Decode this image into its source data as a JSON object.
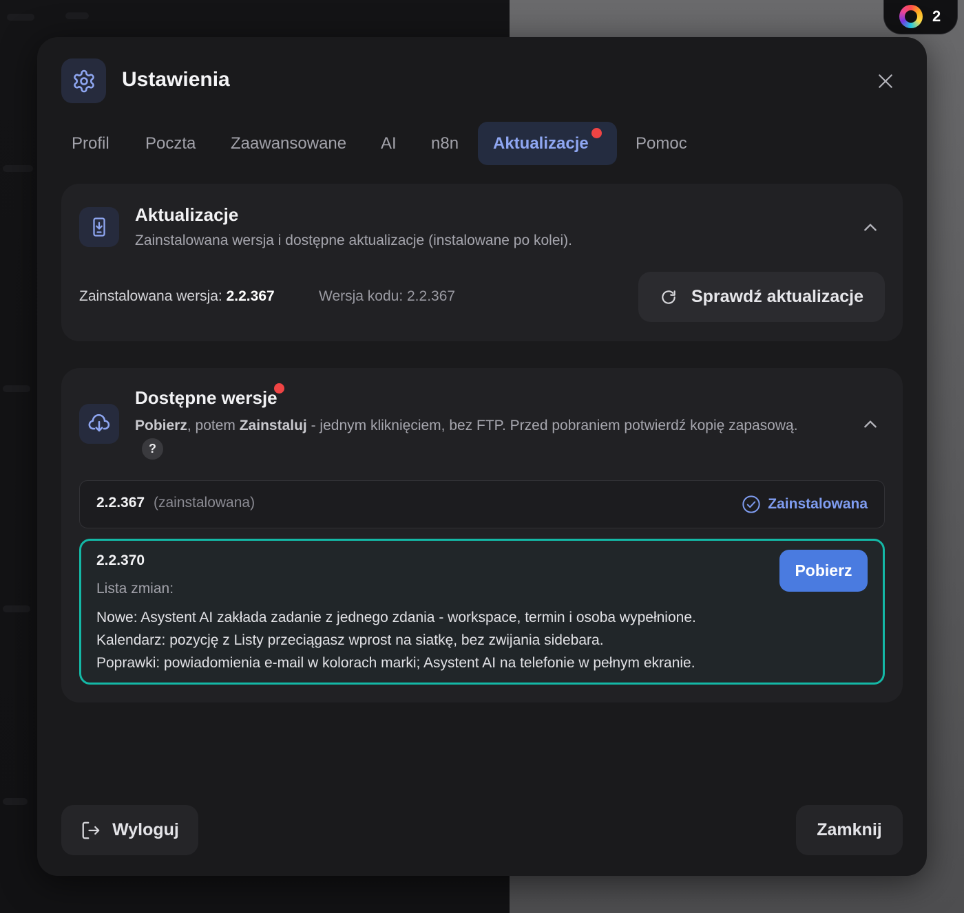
{
  "badge": {
    "count": "2"
  },
  "modal": {
    "title": "Ustawienia",
    "tabs": [
      {
        "label": "Profil"
      },
      {
        "label": "Poczta"
      },
      {
        "label": "Zaawansowane"
      },
      {
        "label": "AI"
      },
      {
        "label": "n8n"
      },
      {
        "label": "Aktualizacje",
        "active": true,
        "notification": true
      },
      {
        "label": "Pomoc"
      }
    ]
  },
  "updates": {
    "title": "Aktualizacje",
    "subtitle": "Zainstalowana wersja i dostępne aktualizacje (instalowane po kolei).",
    "installed_label": "Zainstalowana wersja:",
    "installed_version": "2.2.367",
    "code_version": "Wersja kodu: 2.2.367",
    "check_button": "Sprawdź aktualizacje"
  },
  "available": {
    "title": "Dostępne wersje",
    "desc_bold1": "Pobierz",
    "desc_mid": ", potem ",
    "desc_bold2": "Zainstaluj",
    "desc_rest": " - jednym kliknięciem, bez FTP. Przed pobraniem potwierdź kopię zapasową.",
    "help_label": "?",
    "versions": [
      {
        "version": "2.2.367",
        "note": "(zainstalowana)",
        "status": "Zainstalowana"
      },
      {
        "version": "2.2.370",
        "changelog_label": "Lista zmian:",
        "changes": [
          "Nowe: Asystent AI zakłada zadanie z jednego zdania - workspace, termin i osoba wypełnione.",
          "Kalendarz: pozycję z Listy przeciągasz wprost na siatkę, bez zwijania sidebara.",
          "Poprawki: powiadomienia e-mail w kolorach marki; Asystent AI na telefonie w pełnym ekranie."
        ],
        "action": "Pobierz"
      }
    ]
  },
  "footer": {
    "logout": "Wyloguj",
    "close": "Zamknij"
  },
  "colors": {
    "accent": "#8fa7f2",
    "button": "#4a7be0",
    "highlight_border": "#14b8a6",
    "notification": "#ef4444"
  }
}
